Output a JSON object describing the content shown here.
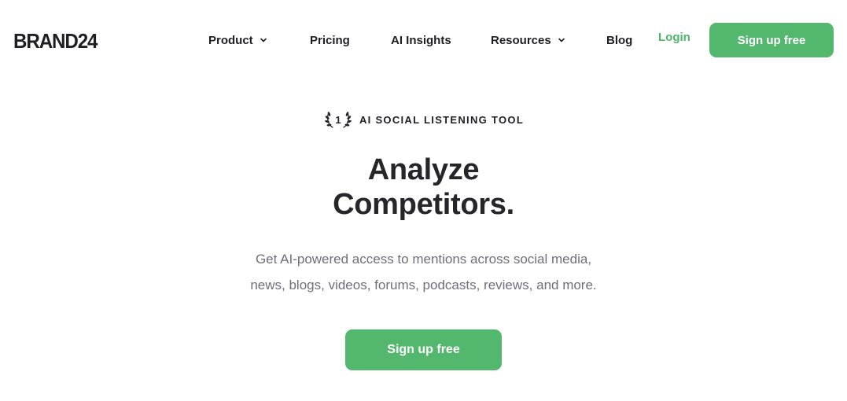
{
  "header": {
    "logo": "BRAND24",
    "nav": [
      {
        "label": "Product",
        "has_dropdown": true
      },
      {
        "label": "Pricing",
        "has_dropdown": false
      },
      {
        "label": "AI Insights",
        "has_dropdown": false
      },
      {
        "label": "Resources",
        "has_dropdown": true
      },
      {
        "label": "Blog",
        "has_dropdown": false
      }
    ],
    "login_label": "Login",
    "signup_label": "Sign up free"
  },
  "hero": {
    "badge_number": "1",
    "eyebrow": "AI SOCIAL LISTENING TOOL",
    "headline_line1": "Analyze",
    "headline_line2": "Competitors.",
    "subtext_line1": "Get AI-powered access to mentions across social media,",
    "subtext_line2": "news, blogs, videos, forums, podcasts, reviews, and more.",
    "cta_label": "Sign up free"
  },
  "colors": {
    "accent": "#53b86d",
    "login_text": "#4db56a",
    "text_dark": "#1f1f23",
    "text_muted": "#6e6e7c",
    "background": "#ffffff"
  },
  "icons": {
    "nav_dropdown": "chevron-down-icon",
    "badge": "laurel-wreath-icon"
  }
}
